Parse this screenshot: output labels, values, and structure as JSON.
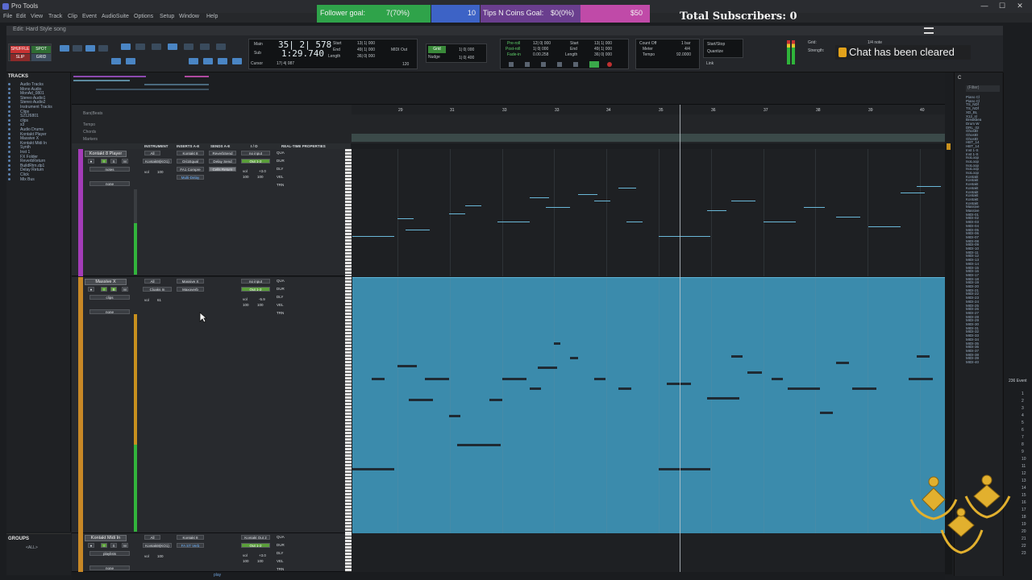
{
  "app": {
    "title": "Pro Tools",
    "document_title": "Edit: Hard Style song"
  },
  "menu": [
    "File",
    "Edit",
    "View",
    "Track",
    "Clip",
    "Event",
    "AudioSuite",
    "Options",
    "Setup",
    "Window",
    "Help"
  ],
  "window_controls": {
    "minimize": "—",
    "maximize": "☐",
    "close": "✕"
  },
  "overlay": {
    "follower_label": "Follower goal:",
    "follower_value": "7(70%)",
    "follower_target": "10",
    "follower_progress": 0.7,
    "tips_label": "Tips N Coins Goal:",
    "tips_value": "$0(0%)",
    "tips_target": "$50",
    "subscribers": "Total Subscribers: 0",
    "chat_notice": "Chat has been cleared"
  },
  "toolbar": {
    "modes": [
      "SHUFFLE",
      "SPOT",
      "SLIP",
      "GRID"
    ],
    "counter_main_label": "Main",
    "counter_sub_label": "Sub",
    "counter_main": "35| 2| 578",
    "counter_sub": "1:29.740",
    "cursor_label": "Cursor",
    "cursor_value": "17| 4| 087",
    "start_label": "Start",
    "end_label": "End",
    "length_label": "Length",
    "start_value": "13| 1| 000",
    "end_value": "49| 1| 000",
    "length_value": "36| 0| 000",
    "midi_out_label": "MIDI Out",
    "tempo_value": "120",
    "grid_label": "Grid",
    "grid_value": "1| 0| 000",
    "nudge_label": "Nudge",
    "nudge_value": "1| 0| 400",
    "preroll_label": "Pre-roll",
    "postroll_label": "Post-roll",
    "fadein_label": "Fade-in",
    "preroll_value": "12| 0| 000",
    "postroll_value": "1| 0| 000",
    "fadein_value": "0.00.258",
    "meter_label": "Meter",
    "tempo_label": "Tempo",
    "countoff_label": "Count Off",
    "meter_value": "4/4",
    "count_bars": "1 bar",
    "start_stop_label": "Start/Stop",
    "quantize_label": "Quantize",
    "link_label": "Link",
    "grid2_label": "Grid:",
    "strength_label": "Strength:",
    "grid2_value": "1/4 note",
    "tempo_display": "92.0000"
  },
  "tracks_panel": {
    "header": "TRACKS",
    "items": [
      "Audio Tracks",
      "Mono Audio",
      "MonAd_0801",
      "Stereo Audio1",
      "Stereo Audio2",
      "Instrument Tracks",
      "Clips",
      "S2126801",
      "clips",
      "s3",
      "Audio Drums",
      "Kontakt Player",
      "Massive X",
      "Kontakt Midi In",
      "Synth",
      "Inst 1",
      "FX Folder",
      "ReverbReturn",
      "BuildRtrn.dp1",
      "Delay Return",
      "Click",
      "Mix Bus"
    ]
  },
  "groups_panel": {
    "header": "GROUPS",
    "all": "<ALL>"
  },
  "rulers": {
    "labels": [
      "Bars|Beats",
      "Tempo",
      "Chords",
      "Markers"
    ],
    "bars": [
      "29",
      "31",
      "33",
      "33",
      "34",
      "35",
      "36",
      "37",
      "38",
      "39",
      "40"
    ]
  },
  "columns": [
    "INSTRUMENT",
    "INSERTS A-E",
    "SENDS A-E",
    "I / O",
    "REAL-TIME PROPERTIES"
  ],
  "tracks": [
    {
      "name": "Kontakt 8 Player",
      "color": "#a43cb8",
      "instrument": "All",
      "instrument_sub": "Kontakt8(KO1)",
      "inserts": [
        "Kontakt 8",
        "Ori1Equal",
        "FA1 Compre",
        "Multi-Delay"
      ],
      "sends": [
        "ReverbSend",
        "Delay Send",
        "Cells Return"
      ],
      "io_in": "no input",
      "io_out": "Out 1-2",
      "vol": "100",
      "pan_l": "100",
      "pan_r": "100",
      "vol_db": "+3.0",
      "rt": [
        "QUA",
        "DUR",
        "DLY",
        "VEL",
        "TRN"
      ],
      "sub_labels": [
        "notes",
        "none"
      ]
    },
    {
      "name": "Massive X",
      "color": "#c88826",
      "instrument": "All",
      "instrument_sub": "Cloaks In",
      "inserts": [
        "Massive X",
        "Maxoverb"
      ],
      "sends": [],
      "io_in": "no input",
      "io_out": "Out 1-2",
      "vol": "61",
      "pan_l": "100",
      "pan_r": "100",
      "vol_db": "-5.9",
      "rt": [
        "QUA",
        "DUR",
        "DLY",
        "VEL",
        "TRN"
      ],
      "sub_labels": [
        "clips",
        "none"
      ]
    },
    {
      "name": "Kontakt Midi In",
      "color": "#c88826",
      "instrument": "All",
      "instrument_sub": "Kontakt8(KO1)",
      "inserts": [
        "Kontakt 8",
        "FA ST Verb"
      ],
      "sends": [],
      "io_in": "Kontakt Out 2",
      "io_out": "Out 1-2",
      "vol": "100",
      "pan_l": "100",
      "pan_r": "100",
      "vol_db": "+3.0",
      "rt": [
        "QUA",
        "DUR",
        "DLY",
        "VEL",
        "TRN"
      ],
      "sub_labels": [
        "playlists",
        "none"
      ]
    }
  ],
  "clips_panel": {
    "filter": "(Filter)",
    "items": [
      "Piano Cl",
      "Piano Cl",
      "TS_NDf",
      "TS_NDf",
      "XD_BL",
      "X12_sl",
      "Breakbea",
      "Drum W",
      "DRL_02",
      "GhostD",
      "GhostD",
      "GhostD",
      "HBT_14",
      "HBT_14",
      "Inst 1-S",
      "Inst 1-S",
      "IsoLoop",
      "IsoLoop",
      "IsoLoop",
      "IsoLoop",
      "IsoLoop",
      "Kontakt",
      "Kontakt",
      "Kontakt",
      "Kontakt",
      "Kontakt",
      "Kontakt",
      "Kontakt",
      "Kontakt",
      "Massive",
      "Massive",
      "MIDI-01",
      "MIDI-02",
      "MIDI-03",
      "MIDI-04",
      "MIDI-05",
      "MIDI-06",
      "MIDI-07",
      "MIDI-08",
      "MIDI-09",
      "MIDI-10",
      "MIDI-11",
      "MIDI-12",
      "MIDI-13",
      "MIDI-14",
      "MIDI-15",
      "MIDI-16",
      "MIDI-17",
      "MIDI-18",
      "MIDI-19",
      "MIDI-20",
      "MIDI-21",
      "MIDI-22",
      "MIDI-23",
      "MIDI-24",
      "MIDI-25",
      "MIDI-26",
      "MIDI-27",
      "MIDI-28",
      "MIDI-29",
      "MIDI-30",
      "MIDI-31",
      "MIDI-32",
      "MIDI-33",
      "MIDI-34",
      "MIDI-35",
      "MIDI-36",
      "MIDI-37",
      "MIDI-38",
      "MIDI-39",
      "MIDI-40"
    ]
  },
  "events_panel": {
    "title": "236 Event",
    "numbers": [
      "1",
      "2",
      "3",
      "4",
      "5",
      "6",
      "7",
      "8",
      "9",
      "10",
      "11",
      "12",
      "13",
      "14",
      "15",
      "16",
      "17",
      "18",
      "19",
      "20",
      "21",
      "22",
      "23"
    ]
  },
  "footer": {
    "play": "play"
  }
}
